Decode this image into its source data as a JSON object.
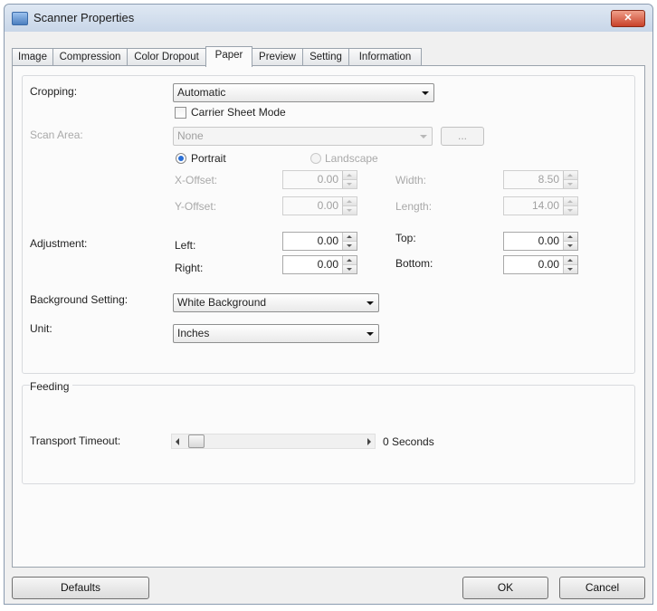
{
  "window": {
    "title": "Scanner Properties",
    "close_label": "✕"
  },
  "tabs": [
    "Image",
    "Compression",
    "Color Dropout",
    "Paper",
    "Preview",
    "Setting",
    "Information"
  ],
  "cropping": {
    "label": "Cropping:",
    "value": "Automatic",
    "carrier_label": "Carrier Sheet Mode"
  },
  "scan_area": {
    "label": "Scan Area:",
    "value": "None",
    "browse_label": "..."
  },
  "orientation": {
    "portrait": "Portrait",
    "landscape": "Landscape"
  },
  "offsets": {
    "x_label": "X-Offset:",
    "x_value": "0.00",
    "y_label": "Y-Offset:",
    "y_value": "0.00",
    "width_label": "Width:",
    "width_value": "8.50",
    "length_label": "Length:",
    "length_value": "14.00"
  },
  "adjustment": {
    "label": "Adjustment:",
    "left_label": "Left:",
    "left_value": "0.00",
    "right_label": "Right:",
    "right_value": "0.00",
    "top_label": "Top:",
    "top_value": "0.00",
    "bottom_label": "Bottom:",
    "bottom_value": "0.00"
  },
  "background": {
    "label": "Background Setting:",
    "value": "White Background"
  },
  "unit": {
    "label": "Unit:",
    "value": "Inches"
  },
  "feeding": {
    "title": "Feeding",
    "timeout_label": "Transport Timeout:",
    "timeout_value": "0 Seconds",
    "timeout_seconds": 0
  },
  "buttons": {
    "defaults": "Defaults",
    "ok": "OK",
    "cancel": "Cancel"
  }
}
